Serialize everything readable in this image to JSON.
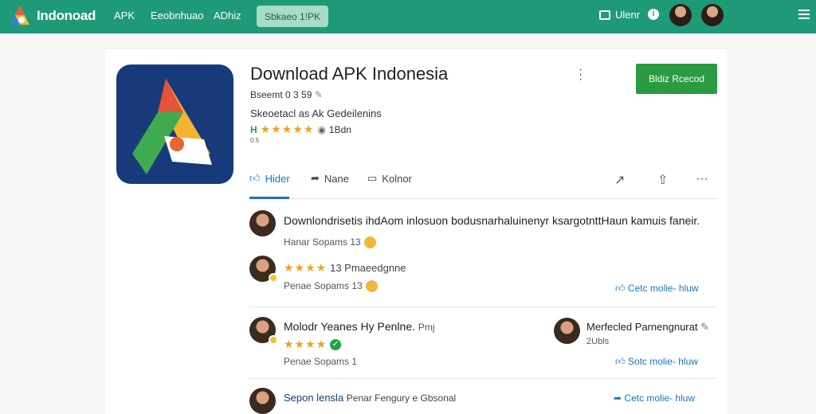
{
  "header": {
    "brand": "Indonoad",
    "nav": [
      "APK",
      "Eeobnhuao",
      "ADhiz"
    ],
    "pill": "Sbkaeo 1!PK",
    "account_label": "Ulenr",
    "info_glyph": "i",
    "menu_icon": "hamburger-icon"
  },
  "app": {
    "title": "Download APK Indonesia",
    "meta1": "Bseemt 0 3 59",
    "meta2": "Skeoetacl as Ak Gedeilenins",
    "rating_prefix": "H",
    "stars": "★★★★★",
    "rating_suffix": "1Bdn",
    "small_count": "0.5",
    "install_label": "Bldiz Rcecod",
    "kebab": "⋮"
  },
  "tabs": [
    {
      "label": "Hider",
      "icon": "thumb-up-icon"
    },
    {
      "label": "Nane",
      "icon": "share-icon"
    },
    {
      "label": "Kolnor",
      "icon": "comment-icon"
    }
  ],
  "tab_actions": [
    "↗",
    "⇧",
    "···"
  ],
  "comments": [
    {
      "line": "Downlondrisetis ihdAom inlosuon bodusnarhaluinenyr ksargotnttHaun kamuis faneir.",
      "sub": "Hanar Sopams 13"
    },
    {
      "stars": "★★★★",
      "line": "13 Pmaeedgnne",
      "sub": "Penae Sopams 13",
      "link": "Cetc molie- hluw"
    },
    {
      "line": "Molodr Yeanes Hy Penlne.",
      "extra": "Pmj",
      "stars": "★★★★",
      "sub": "Penae Sopams 1",
      "link": "Sotc molie- hluw",
      "right_line": "Merfecled Parnengnurat",
      "right_sub": "2Ubls"
    },
    {
      "line": "Sepon lensla",
      "extra": "Penar Fengury e Gbsonal",
      "link": "Cetc molie- hluw"
    }
  ],
  "colors": {
    "topbar": "#1e9a78",
    "install": "#2a9a43",
    "accent": "#1a73c8",
    "star": "#f4a11a"
  }
}
